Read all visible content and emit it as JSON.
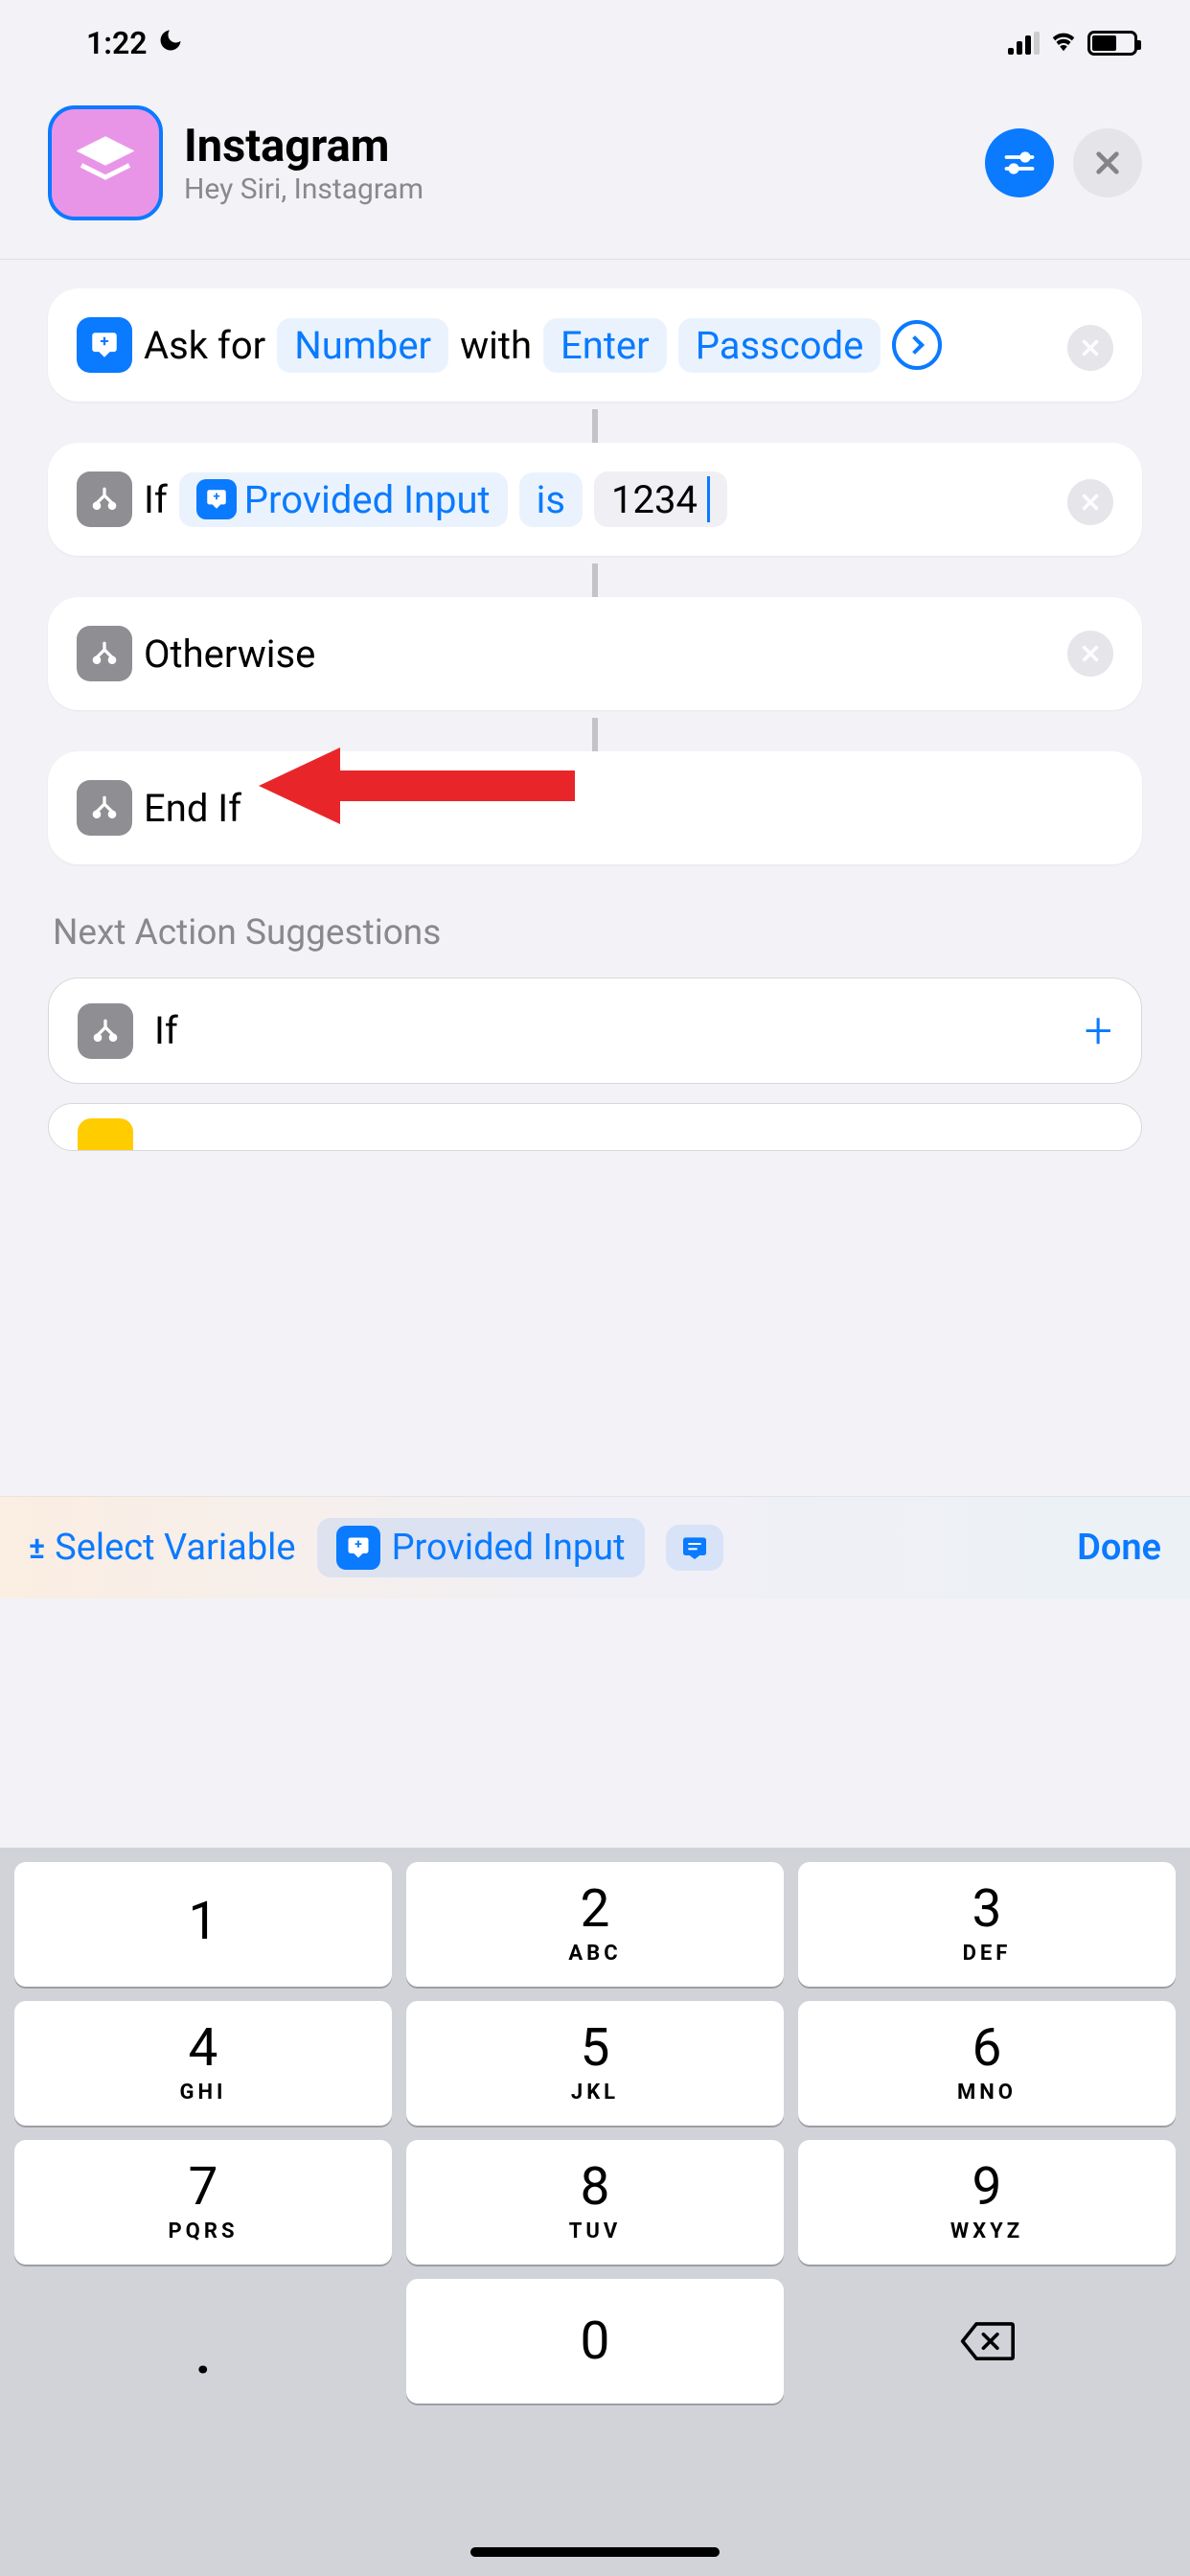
{
  "status": {
    "time": "1:22"
  },
  "header": {
    "title": "Instagram",
    "subtitle": "Hey Siri, Instagram"
  },
  "actions": {
    "ask": {
      "prefix": "Ask for",
      "type": "Number",
      "with": "with",
      "prompt_part1": "Enter",
      "prompt_part2": "Passcode"
    },
    "if": {
      "label": "If",
      "variable": "Provided Input",
      "condition": "is",
      "value": "1234"
    },
    "otherwise": {
      "label": "Otherwise"
    },
    "endif": {
      "label": "End If"
    }
  },
  "suggestions": {
    "title": "Next Action Suggestions",
    "items": [
      {
        "label": "If"
      }
    ]
  },
  "variable_bar": {
    "select": "Select Variable",
    "provided": "Provided Input",
    "done": "Done"
  },
  "keypad": {
    "keys": [
      {
        "num": "1",
        "letters": ""
      },
      {
        "num": "2",
        "letters": "ABC"
      },
      {
        "num": "3",
        "letters": "DEF"
      },
      {
        "num": "4",
        "letters": "GHI"
      },
      {
        "num": "5",
        "letters": "JKL"
      },
      {
        "num": "6",
        "letters": "MNO"
      },
      {
        "num": "7",
        "letters": "PQRS"
      },
      {
        "num": "8",
        "letters": "TUV"
      },
      {
        "num": "9",
        "letters": "WXYZ"
      },
      {
        "num": ".",
        "letters": ""
      },
      {
        "num": "0",
        "letters": ""
      }
    ]
  }
}
